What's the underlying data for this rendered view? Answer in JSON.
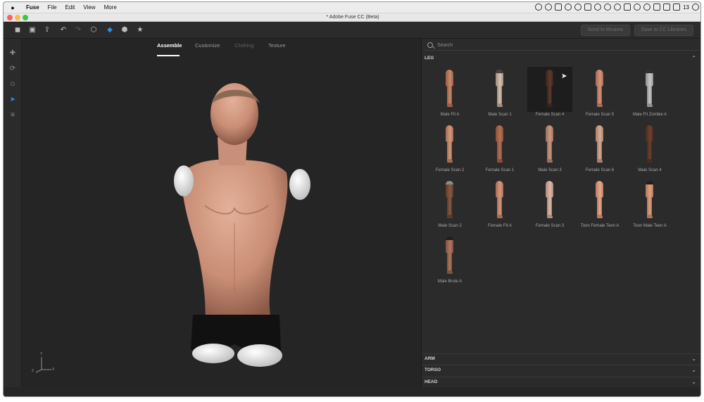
{
  "menubar": {
    "apple": "",
    "items": [
      "Fuse",
      "File",
      "Edit",
      "View",
      "More"
    ],
    "battery_num": "13"
  },
  "window": {
    "title": "* Adobe Fuse CC (Beta)"
  },
  "toolbar": {
    "icons": [
      "save-icon",
      "open-icon",
      "export-icon",
      "undo-icon",
      "redo-icon",
      "cube-icon",
      "mixamo-icon",
      "box-icon",
      "favorite-icon"
    ],
    "send_button": "Send to Mixamo",
    "library_button": "Save to CC Libraries"
  },
  "lefttools": [
    "move-icon",
    "rotate-camera-icon",
    "smile-icon",
    "select-icon",
    "align-icon"
  ],
  "viewport": {
    "tabs": [
      {
        "label": "Assemble",
        "state": "active"
      },
      {
        "label": "Customize",
        "state": "normal"
      },
      {
        "label": "Clothing",
        "state": "disabled"
      },
      {
        "label": "Texture",
        "state": "normal"
      }
    ],
    "axis": {
      "y": "Y",
      "x": "X",
      "z": "Z"
    }
  },
  "library": {
    "search_placeholder": "Search",
    "leg_section": "LEG",
    "items": [
      {
        "label": "Male Fit A",
        "skin": "#c98a6d",
        "shade": "#9b5f45"
      },
      {
        "label": "Male Scan 1",
        "skin": "#d6c3b3",
        "shade": "#9e8c7e",
        "band": "#4a403a"
      },
      {
        "label": "Female Scan 4",
        "skin": "#5e3a2e",
        "shade": "#3b241c",
        "selected": true
      },
      {
        "label": "Female Scan 5",
        "skin": "#d4967a",
        "shade": "#a56a52"
      },
      {
        "label": "Male Fit Zombie A",
        "skin": "#c9c9c9",
        "shade": "#8f8f8f",
        "band": "#2e2e2e"
      },
      {
        "label": "Female Scan 2",
        "skin": "#d49a7c",
        "shade": "#a36c52"
      },
      {
        "label": "Female Scan 1",
        "skin": "#b87256",
        "shade": "#8a4f38"
      },
      {
        "label": "Male Scan 3",
        "skin": "#cc9a83",
        "shade": "#9c6e5a"
      },
      {
        "label": "Female Scan 6",
        "skin": "#d8ab95",
        "shade": "#a8806b"
      },
      {
        "label": "Male Scan 4",
        "skin": "#6e4231",
        "shade": "#4a2a1e"
      },
      {
        "label": "Male Scan 2",
        "skin": "#8a5a45",
        "shade": "#5e3a2b",
        "band": "#8a8a8a"
      },
      {
        "label": "Female Fit A",
        "skin": "#d59a7d",
        "shade": "#a66d54"
      },
      {
        "label": "Female Scan 3",
        "skin": "#e0b8a6",
        "shade": "#b08b7a"
      },
      {
        "label": "Toon Female Teen A",
        "skin": "#e6a98c",
        "shade": "#b97c62"
      },
      {
        "label": "Toon Male Teen A",
        "skin": "#dfa180",
        "shade": "#b07558",
        "band": "#1e1e1e"
      },
      {
        "label": "Male Brute A",
        "skin": "#b2785e",
        "shade": "#80523d",
        "band": "#1e1e1e"
      }
    ],
    "sections": [
      "ARM",
      "TORSO",
      "HEAD"
    ]
  }
}
